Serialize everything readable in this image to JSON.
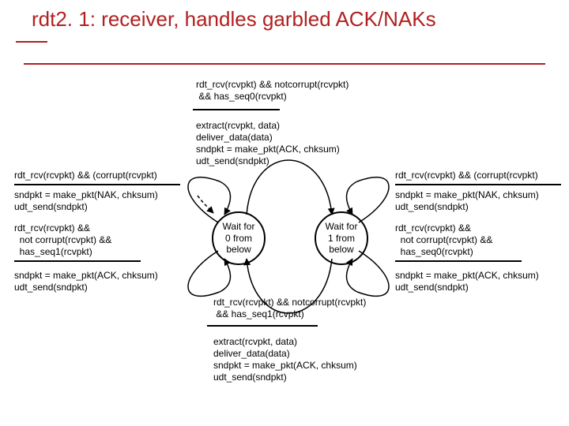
{
  "title": "rdt2. 1: receiver, handles garbled\nACK/NAKs",
  "top_event": "rdt_rcv(rcvpkt) && notcorrupt(rcvpkt)\n && has_seq0(rcvpkt)",
  "top_action": "extract(rcvpkt, data)\ndeliver_data(data)\nsndpkt = make_pkt(ACK, chksum)\nudt_send(sndpkt)",
  "left_corrupt_event": "rdt_rcv(rcvpkt) && (corrupt(rcvpkt)",
  "left_corrupt_action": "sndpkt = make_pkt(NAK, chksum)\nudt_send(sndpkt)",
  "left_seq1_event": "rdt_rcv(rcvpkt) &&\n  not corrupt(rcvpkt) &&\n  has_seq1(rcvpkt)",
  "left_seq1_action": "sndpkt = make_pkt(ACK, chksum)\nudt_send(sndpkt)",
  "right_corrupt_event": "rdt_rcv(rcvpkt) && (corrupt(rcvpkt)",
  "right_corrupt_action": "sndpkt = make_pkt(NAK, chksum)\nudt_send(sndpkt)",
  "right_seq0_event": "rdt_rcv(rcvpkt) &&\n  not corrupt(rcvpkt) &&\n  has_seq0(rcvpkt)",
  "right_seq0_action": "sndpkt = make_pkt(ACK, chksum)\nudt_send(sndpkt)",
  "bottom_event": "rdt_rcv(rcvpkt) && notcorrupt(rcvpkt)\n && has_seq1(rcvpkt)",
  "bottom_action": "extract(rcvpkt, data)\ndeliver_data(data)\nsndpkt = make_pkt(ACK, chksum)\nudt_send(sndpkt)",
  "state0": "Wait for\n0 from\nbelow",
  "state1": "Wait for\n1 from\nbelow"
}
